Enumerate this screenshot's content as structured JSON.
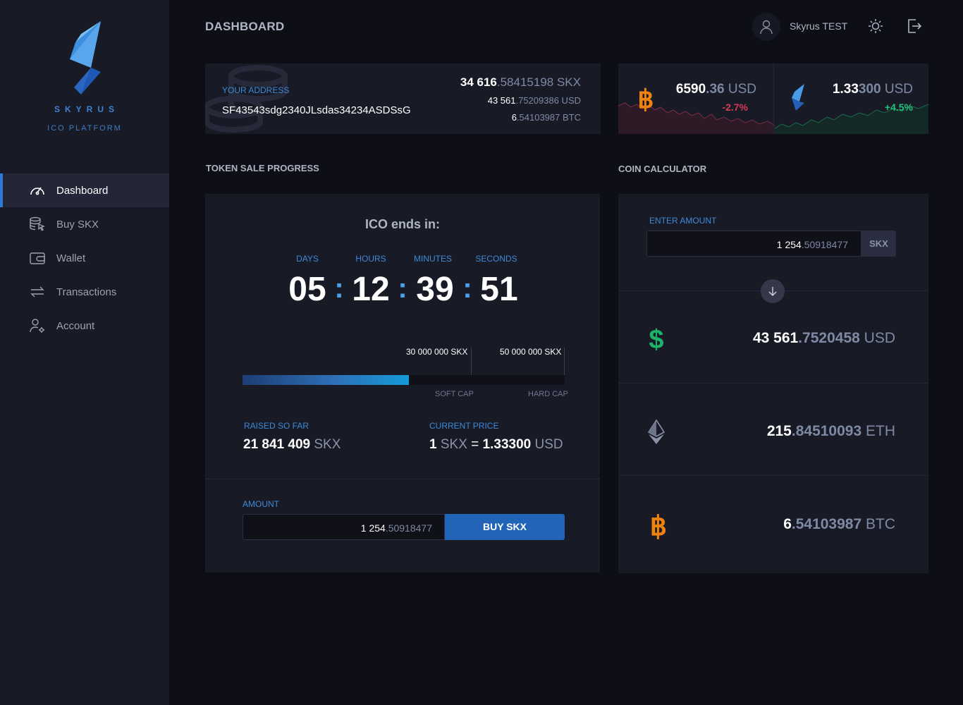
{
  "brand": {
    "name": "SKYRUS",
    "subtitle": "ICO PLATFORM"
  },
  "sidebar": {
    "items": [
      {
        "label": "Dashboard",
        "icon": "dashboard-gauge-icon",
        "active": true
      },
      {
        "label": "Buy SKX",
        "icon": "coins-cursor-icon",
        "active": false
      },
      {
        "label": "Wallet",
        "icon": "wallet-icon",
        "active": false
      },
      {
        "label": "Transactions",
        "icon": "arrows-exchange-icon",
        "active": false
      },
      {
        "label": "Account",
        "icon": "user-settings-icon",
        "active": false
      }
    ]
  },
  "header": {
    "title": "DASHBOARD",
    "user_name": "Skyrus TEST"
  },
  "address_card": {
    "label": "YOUR ADDRESS",
    "address": "SF43543sdg2340JLsdas34234ASDSsG",
    "balance_skx_main": "34 616",
    "balance_skx_dec": ".58415198",
    "balance_skx_unit": " SKX",
    "balance_usd_main": "43 561",
    "balance_usd_dec": ".75209386",
    "balance_usd_unit": " USD",
    "balance_btc_main": "6",
    "balance_btc_dec": ".54103987",
    "balance_btc_unit": " BTC"
  },
  "prices": {
    "btc": {
      "main": "6590",
      "dec": ".36",
      "unit": " USD",
      "change": "-2.7%",
      "color": "#d63a56"
    },
    "skx": {
      "main": "1.33",
      "dec": "300",
      "unit": " USD",
      "change": "+4.5%",
      "color": "#24c17a"
    }
  },
  "token_sale": {
    "section_title": "TOKEN SALE PROGRESS",
    "ico_title": "ICO ends in:",
    "countdown_labels": [
      "DAYS",
      "HOURS",
      "MINUTES",
      "SECONDS"
    ],
    "countdown_values": [
      "05",
      "12",
      "39",
      "51"
    ],
    "soft_cap_amount": "30 000 000 SKX",
    "hard_cap_amount": "50 000 000 SKX",
    "soft_cap_label": "SOFT CAP",
    "hard_cap_label": "HARD CAP",
    "progress": 0.516,
    "raised_label": "RAISED SO FAR",
    "raised_value": "21 841 409",
    "raised_unit": " SKX",
    "price_label": "CURRENT PRICE",
    "price_one": "1",
    "price_skx": " SKX",
    "price_eq": " = ",
    "price_value": "1.33300",
    "price_unit": " USD",
    "amount_label": "AMOUNT",
    "amount_main": "1 254",
    "amount_dec": ".50918477",
    "buy_label": "BUY SKX"
  },
  "calculator": {
    "section_title": "COIN CALCULATOR",
    "enter_label": "ENTER AMOUNT",
    "input_main": "1 254",
    "input_dec": ".50918477",
    "input_unit": "SKX",
    "results": [
      {
        "icon": "dollar-icon",
        "main": "43 561",
        "dec": ".7520458",
        "unit": " USD",
        "color": "#1db36a"
      },
      {
        "icon": "ethereum-icon",
        "main": "215",
        "dec": ".84510093",
        "unit": " ETH",
        "color": "#8b93a8"
      },
      {
        "icon": "bitcoin-icon",
        "main": "6",
        "dec": ".54103987",
        "unit": " BTC",
        "color": "#f0820f"
      }
    ]
  }
}
